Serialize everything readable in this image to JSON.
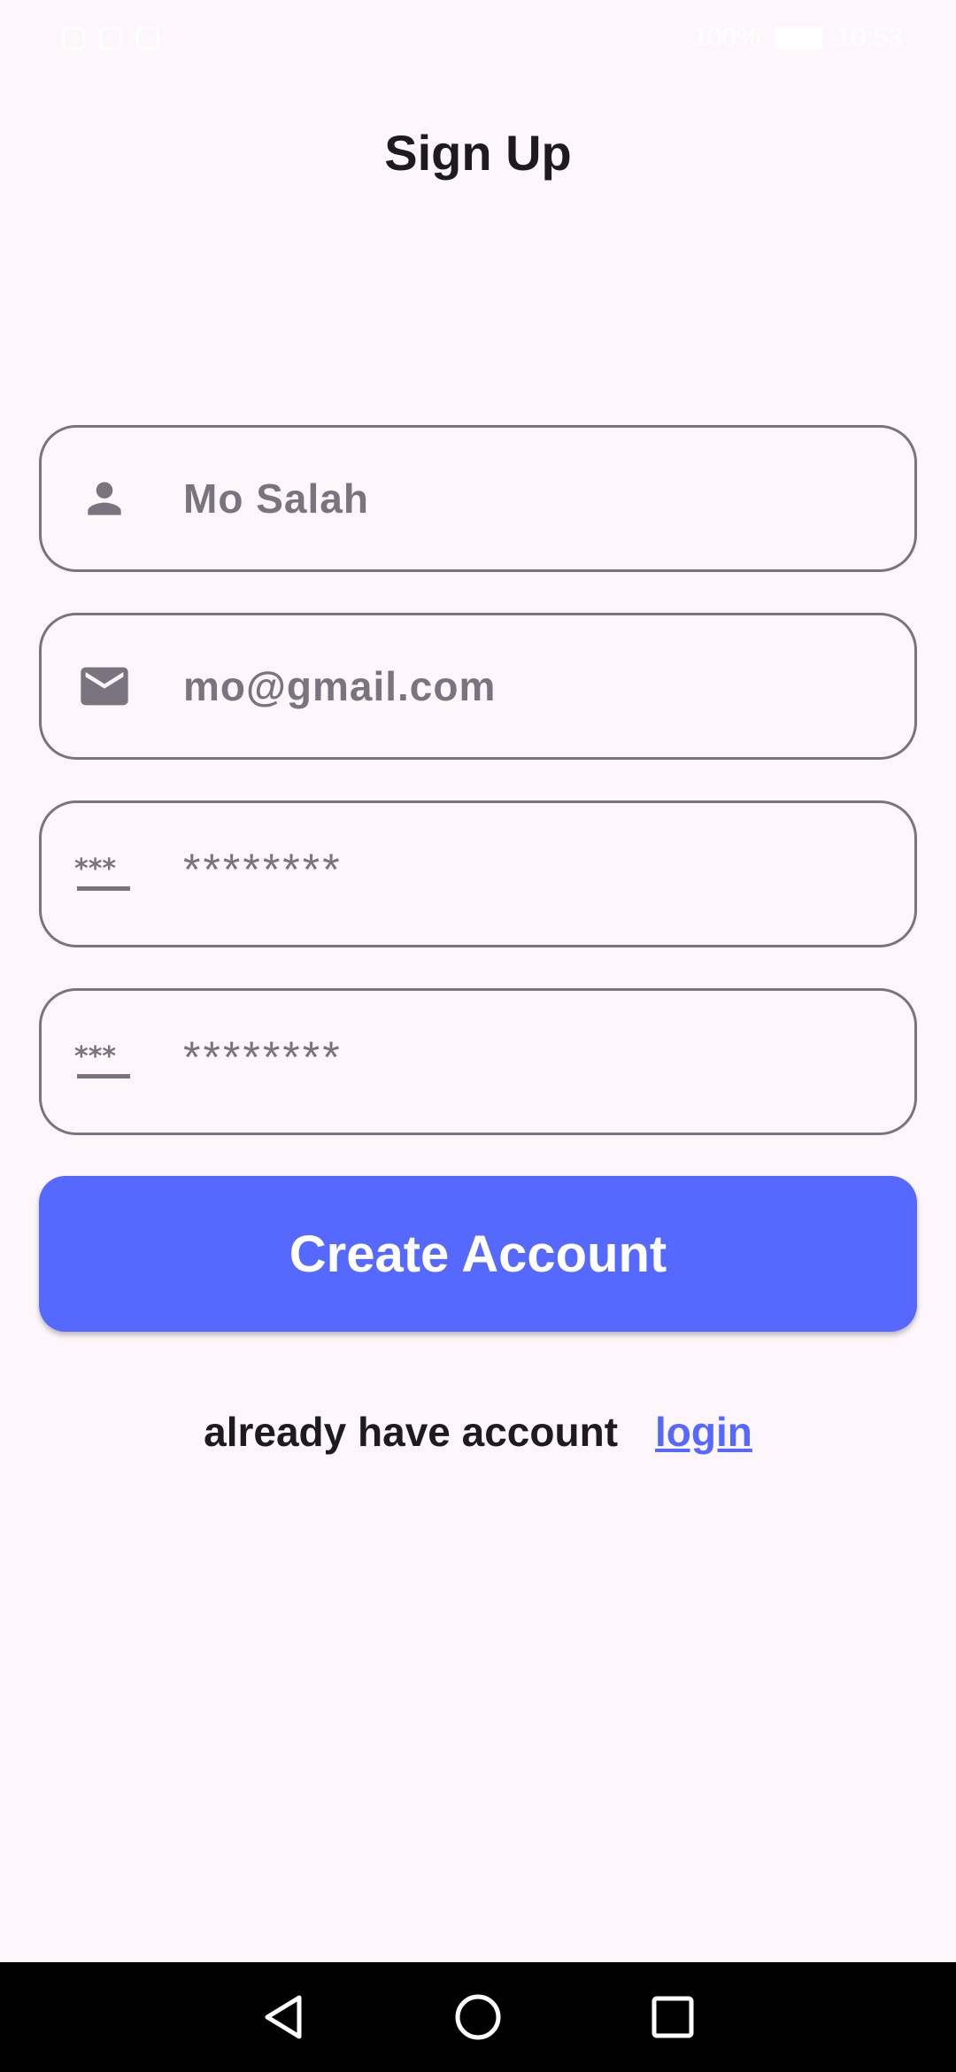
{
  "status_bar": {
    "battery": "100%",
    "time": "10:53"
  },
  "page": {
    "title": "Sign Up"
  },
  "form": {
    "name": {
      "icon": "person-icon",
      "value": "Mo Salah"
    },
    "email": {
      "icon": "mail-icon",
      "value": "mo@gmail.com"
    },
    "password": {
      "icon": "password-icon",
      "value": "********"
    },
    "confirm_password": {
      "icon": "password-icon",
      "value": "********"
    },
    "submit_label": "Create Account"
  },
  "footer": {
    "prompt": "already have account",
    "link_label": "login"
  },
  "colors": {
    "background": "#fdf7fc",
    "accent": "#5669ff",
    "field_border": "#79747e",
    "text": "#1d1b20"
  }
}
